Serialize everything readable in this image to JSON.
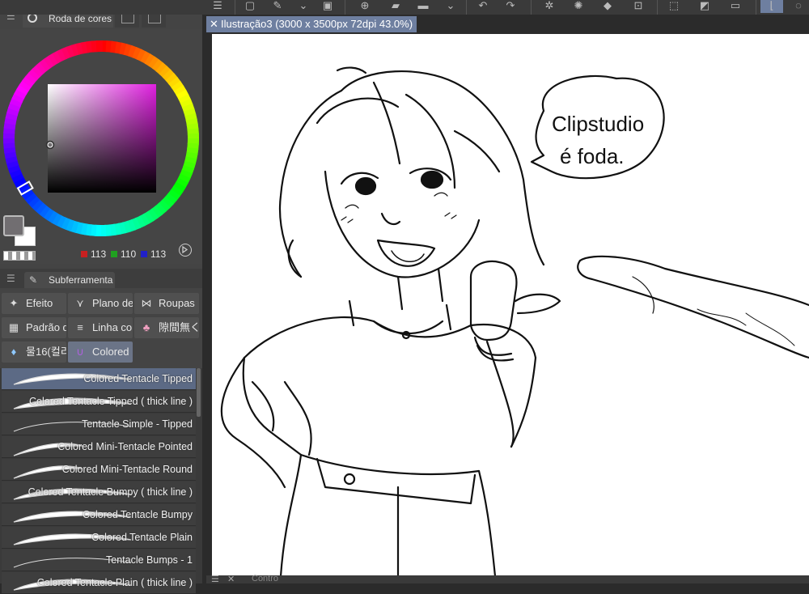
{
  "color_panel": {
    "title": "Roda de cores",
    "rgb": {
      "r": "113",
      "g": "110",
      "b": "113"
    },
    "swatch_colors": {
      "r": "#c82020",
      "g": "#20a020",
      "b": "#2020c8"
    }
  },
  "subtool_panel": {
    "title": "Subferramenta",
    "groups": [
      {
        "label": "Efeito",
        "icon": "sparkle-icon"
      },
      {
        "label": "Plano de",
        "icon": "grass-icon"
      },
      {
        "label": "Roupas",
        "icon": "bow-icon"
      },
      {
        "label": "Padrão d",
        "icon": "pattern-icon"
      },
      {
        "label": "Linha cor",
        "icon": "lines-icon"
      },
      {
        "label": "隙間無く",
        "icon": "cupcake-icon"
      },
      {
        "label": "물16(컬리",
        "icon": "droplet-icon"
      },
      {
        "label": "Colored",
        "icon": "tentacle-icon"
      }
    ],
    "brushes": [
      "Colored Tentacle Tipped",
      "Colored Tentacle Tipped ( thick line )",
      "Tentacle Simple - Tipped",
      "Colored Mini-Tentacle Pointed",
      "Colored Mini-Tentacle Round",
      "Colored Tentacle Bumpy ( thick line )",
      "Colored Tentacle Bumpy",
      "Colored Tentacle Plain",
      "Tentacle Bumps - 1",
      "Colored Tentacle Plain ( thick line )"
    ]
  },
  "document": {
    "tab_title": "Ilustração3 (3000 x 3500px 72dpi 43.0%)",
    "speech_line1": "Clipstudio",
    "speech_line2": "é foda."
  },
  "bottom": {
    "label": "Contro"
  }
}
